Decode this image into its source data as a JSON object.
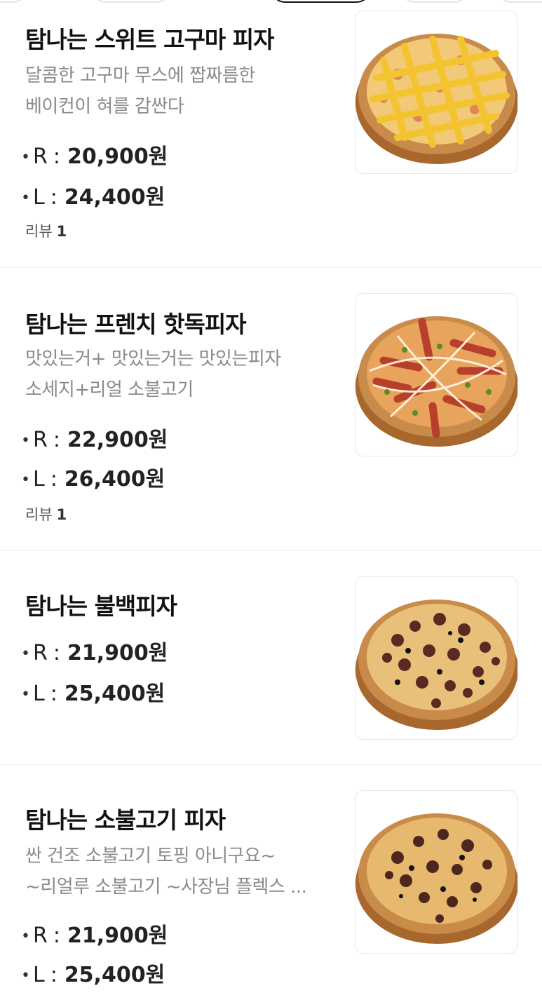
{
  "menu": {
    "items": [
      {
        "name": "탐나는 스위트 고구마 피자",
        "desc": [
          "달콤한 고구마 무스에 짭짜름한",
          "베이컨이 혀를 감싼다"
        ],
        "prices": [
          {
            "size": "R",
            "amount": "20,900원"
          },
          {
            "size": "L",
            "amount": "24,400원"
          }
        ],
        "review_label": "리뷰",
        "review_count": "1",
        "image": "sweet-potato-pizza"
      },
      {
        "name": "탐나는 프렌치 핫독피자",
        "desc": [
          "맛있는거+ 맛있는거는 맛있는피자",
          "소세지+리얼 소불고기"
        ],
        "prices": [
          {
            "size": "R",
            "amount": "22,900원"
          },
          {
            "size": "L",
            "amount": "26,400원"
          }
        ],
        "review_label": "리뷰",
        "review_count": "1",
        "image": "hotdog-pizza"
      },
      {
        "name": "탐나는 불백피자",
        "desc": [],
        "prices": [
          {
            "size": "R",
            "amount": "21,900원"
          },
          {
            "size": "L",
            "amount": "25,400원"
          }
        ],
        "image": "bulbaek-pizza"
      },
      {
        "name": "탐나는 소불고기 피자",
        "desc": [
          "싼 건조 소불고기 토핑 아니구요~",
          "~리얼루 소불고기 ~사장님 플렉스 ..."
        ],
        "prices": [
          {
            "size": "R",
            "amount": "21,900원"
          },
          {
            "size": "L",
            "amount": "25,400원"
          }
        ],
        "image": "bulgogi-pizza"
      }
    ],
    "bullet": "•",
    "colon": ":"
  },
  "colors": {
    "text_primary": "#111111",
    "text_secondary": "#8a8a8a",
    "divider": "#efefef",
    "crust": "#c98b4a",
    "board": "#b87a3c"
  }
}
